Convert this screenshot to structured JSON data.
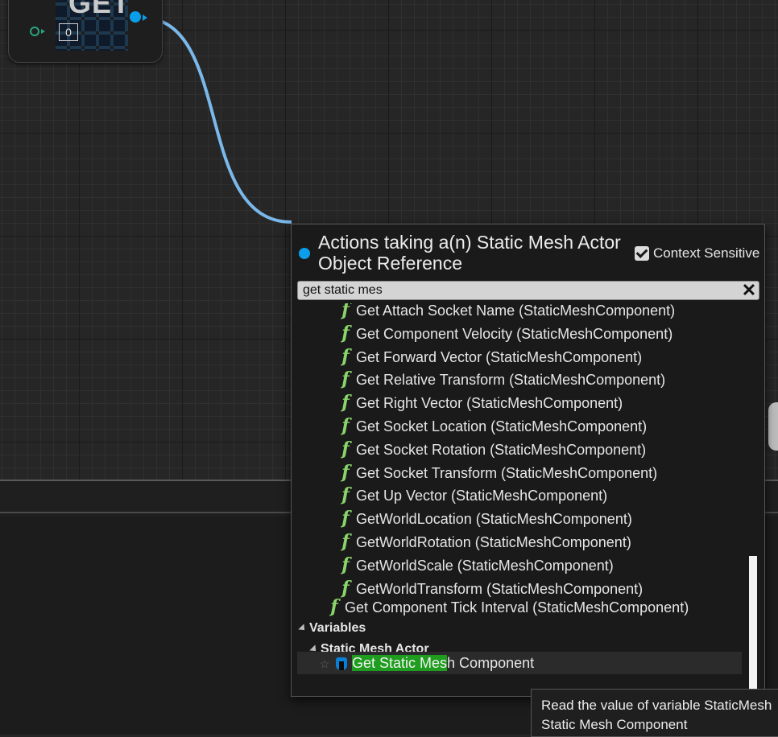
{
  "node": {
    "title": "GET",
    "index_value": "0"
  },
  "menu": {
    "title": "Actions taking a(n) Static Mesh Actor Object Reference",
    "context_sensitive_label": "Context Sensitive",
    "context_sensitive_checked": true,
    "search_value": "get static mes",
    "search_clear_glyph": "✕",
    "function_icon_glyph": "f",
    "functions": [
      "Get Attach Socket Name (StaticMeshComponent)",
      "Get Component Velocity (StaticMeshComponent)",
      "Get Forward Vector (StaticMeshComponent)",
      "Get Relative Transform (StaticMeshComponent)",
      "Get Right Vector (StaticMeshComponent)",
      "Get Socket Location (StaticMeshComponent)",
      "Get Socket Rotation (StaticMeshComponent)",
      "Get Socket Transform (StaticMeshComponent)",
      "Get Up Vector (StaticMeshComponent)",
      "GetWorldLocation (StaticMeshComponent)",
      "GetWorldRotation (StaticMeshComponent)",
      "GetWorldScale (StaticMeshComponent)",
      "GetWorldTransform (StaticMeshComponent)"
    ],
    "outer_function": "Get Component Tick Interval (StaticMeshComponent)",
    "category_variables": "Variables",
    "category_static_mesh_actor": "Static Mesh Actor",
    "selected_item": {
      "highlight": "Get Static Mes",
      "rest": "h Component",
      "star_glyph": "☆"
    },
    "scroll_position": 0.65
  },
  "tooltip": {
    "line1": "Read the value of variable StaticMesh",
    "line2": "Static Mesh Component"
  },
  "colors": {
    "object_pin": "#0a9eea",
    "function_icon": "#8ad56a",
    "match_highlight": "#1e9d1e"
  }
}
